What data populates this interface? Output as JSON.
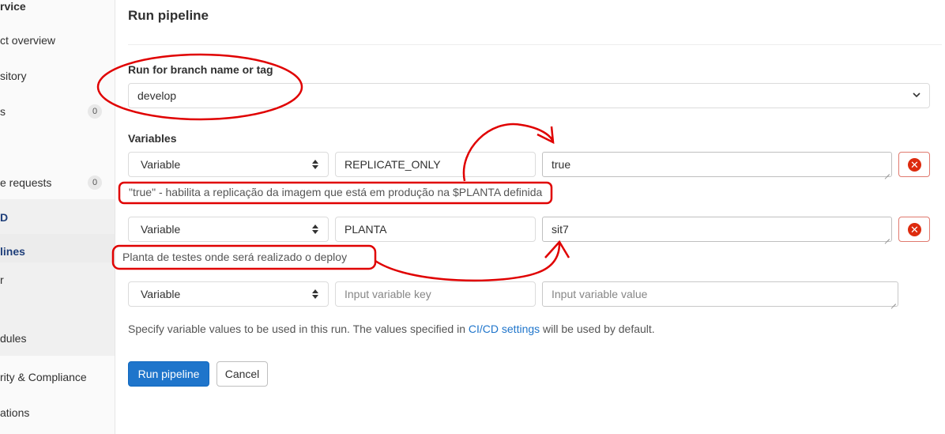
{
  "sidebar": {
    "items": [
      {
        "label": "rvice",
        "count": ""
      },
      {
        "label": "ct overview",
        "count": ""
      },
      {
        "label": "sitory",
        "count": ""
      },
      {
        "label": "s",
        "count": "0"
      },
      {
        "label": "e requests",
        "count": "0"
      },
      {
        "label": "D",
        "count": ""
      },
      {
        "label": "lines",
        "count": ""
      },
      {
        "label": "r",
        "count": ""
      },
      {
        "label": "dules",
        "count": ""
      },
      {
        "label": "rity & Compliance",
        "count": ""
      },
      {
        "label": "ations",
        "count": ""
      }
    ]
  },
  "page": {
    "title": "Run pipeline",
    "branch_label": "Run for branch name or tag",
    "branch_value": "develop",
    "variables_label": "Variables",
    "variables": [
      {
        "type": "Variable",
        "key": "REPLICATE_ONLY",
        "value": "true",
        "note": "\"true\" - habilita a replicação da imagem que está em produção na $PLANTA definida"
      },
      {
        "type": "Variable",
        "key": "PLANTA",
        "value": "sit7",
        "note": "Planta de testes onde será realizado o deploy"
      },
      {
        "type": "Variable",
        "key_placeholder": "Input variable key",
        "value_placeholder": "Input variable value"
      }
    ],
    "help_prefix": "Specify variable values to be used in this run. The values specified in ",
    "help_link": "CI/CD settings",
    "help_suffix": " will be used by default.",
    "run_button": "Run pipeline",
    "cancel_button": "Cancel"
  },
  "colors": {
    "primary": "#1f75cb",
    "danger": "#dd2b0e",
    "annotation": "#e00000"
  },
  "icons": [
    "chevron-down-icon",
    "select-arrows-icon",
    "remove-circle-icon",
    "resize-grip-icon"
  ]
}
